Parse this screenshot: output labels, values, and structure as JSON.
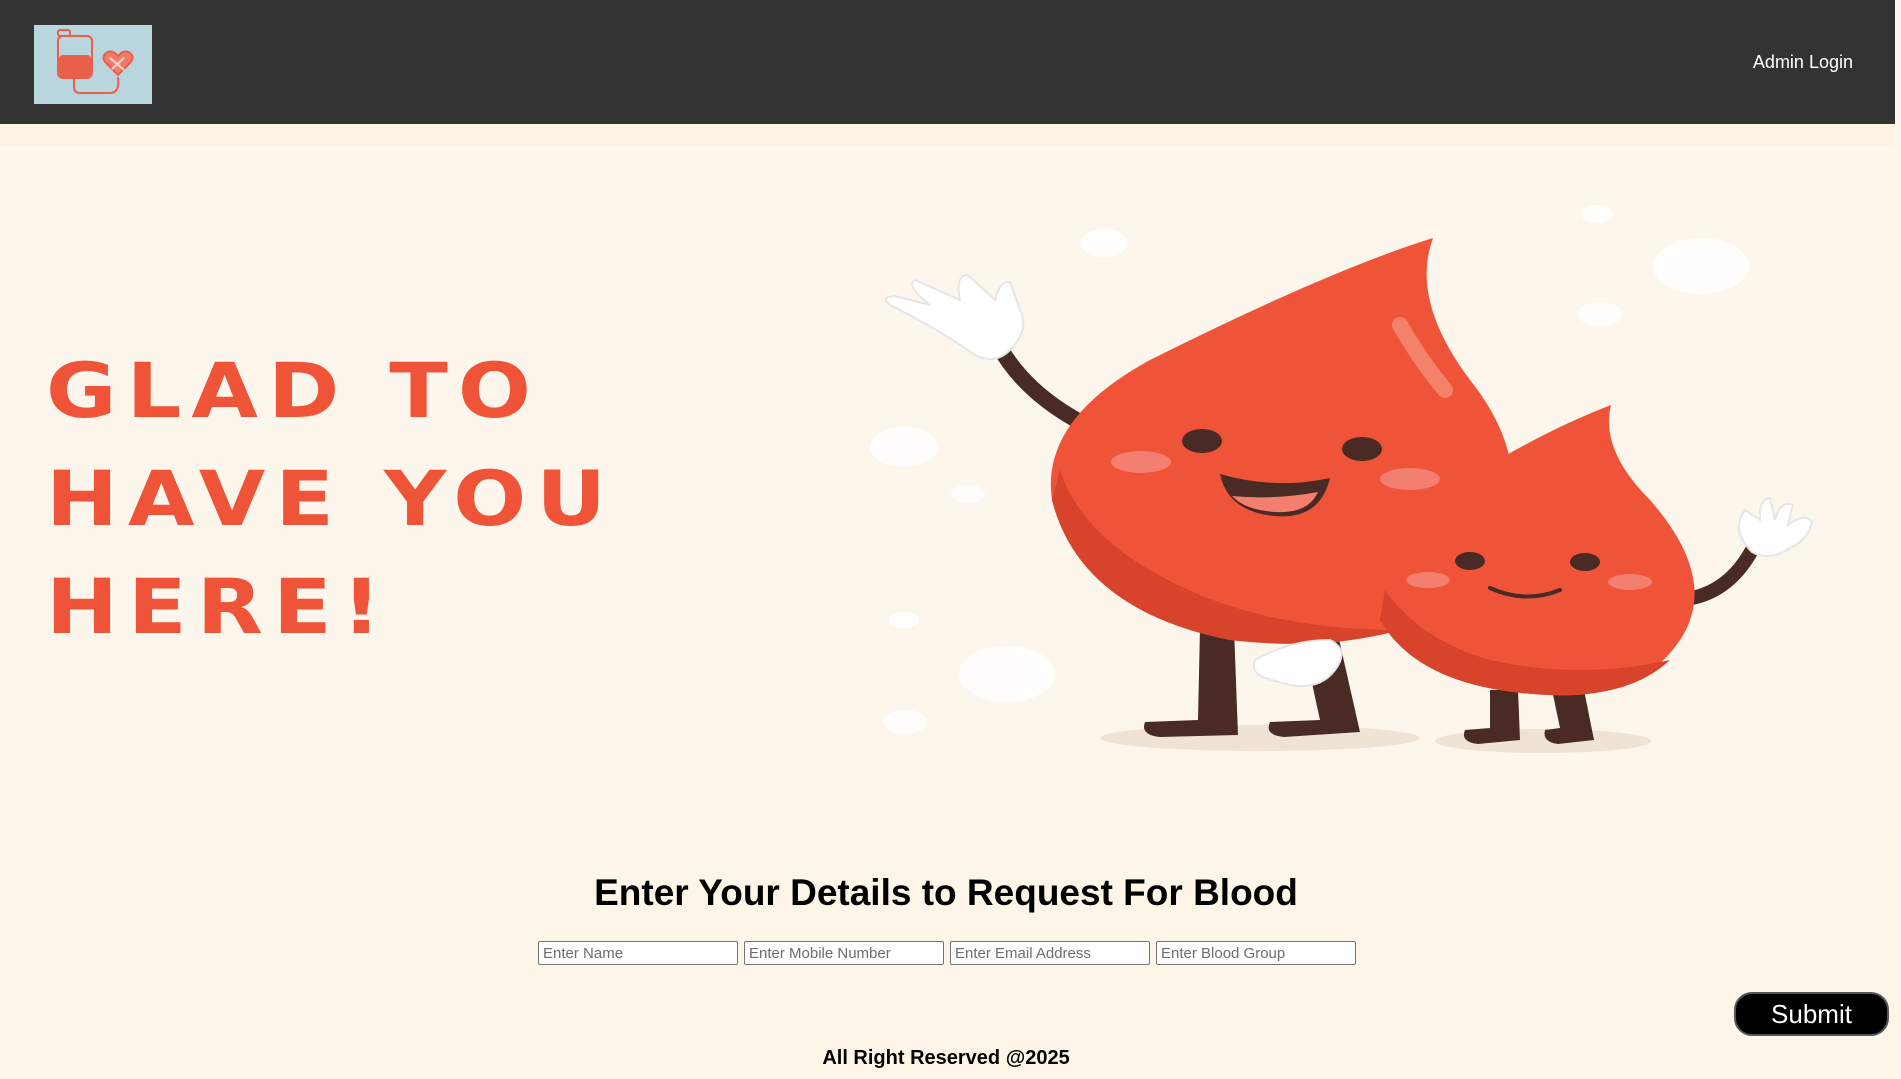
{
  "navbar": {
    "logo_icon": "blood-bag-heart-icon",
    "admin_login": "Admin Login"
  },
  "hero": {
    "lines": [
      "GLAD TO",
      "HAVE YOU",
      "HERE!"
    ],
    "illustration": "blood-drop-characters"
  },
  "form": {
    "title": "Enter Your Details to Request For Blood",
    "name_placeholder": "Enter Name",
    "mobile_placeholder": "Enter Mobile Number",
    "email_placeholder": "Enter Email Address",
    "blood_group_placeholder": "Enter Blood Group",
    "submit_label": "Submit"
  },
  "footer": {
    "text": "All Right Reserved @2025"
  },
  "colors": {
    "navbar": "#333333",
    "accent_red": "#f05438",
    "page_background": "#fdf5e8"
  }
}
